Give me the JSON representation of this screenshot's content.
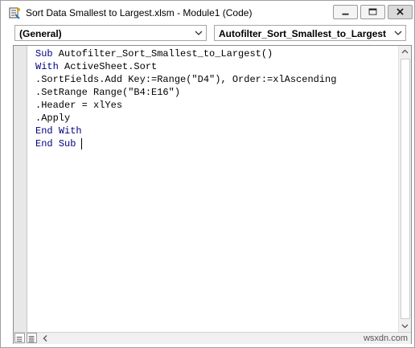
{
  "window": {
    "title": "Sort Data Smallest to Largest.xlsm - Module1 (Code)",
    "icon": "vba-module-icon",
    "controls": [
      "minimize-icon",
      "maximize-icon",
      "close-icon"
    ]
  },
  "toolbar": {
    "object_dropdown": "(General)",
    "procedure_dropdown": "Autofilter_Sort_Smallest_to_Largest"
  },
  "code": {
    "lines": [
      "Sub Autofilter_Sort_Smallest_to_Largest()",
      "With ActiveSheet.Sort",
      ".SortFields.Add Key:=Range(\"D4\"), Order:=xlAscending",
      ".SetRange Range(\"B4:E16\")",
      ".Header = xlYes",
      ".Apply",
      "End With",
      "End Sub"
    ]
  },
  "footer": {
    "watermark": "wsxdn.com"
  },
  "colors": {
    "keyword": "#00007f",
    "text": "#000000",
    "background": "#ffffff"
  }
}
